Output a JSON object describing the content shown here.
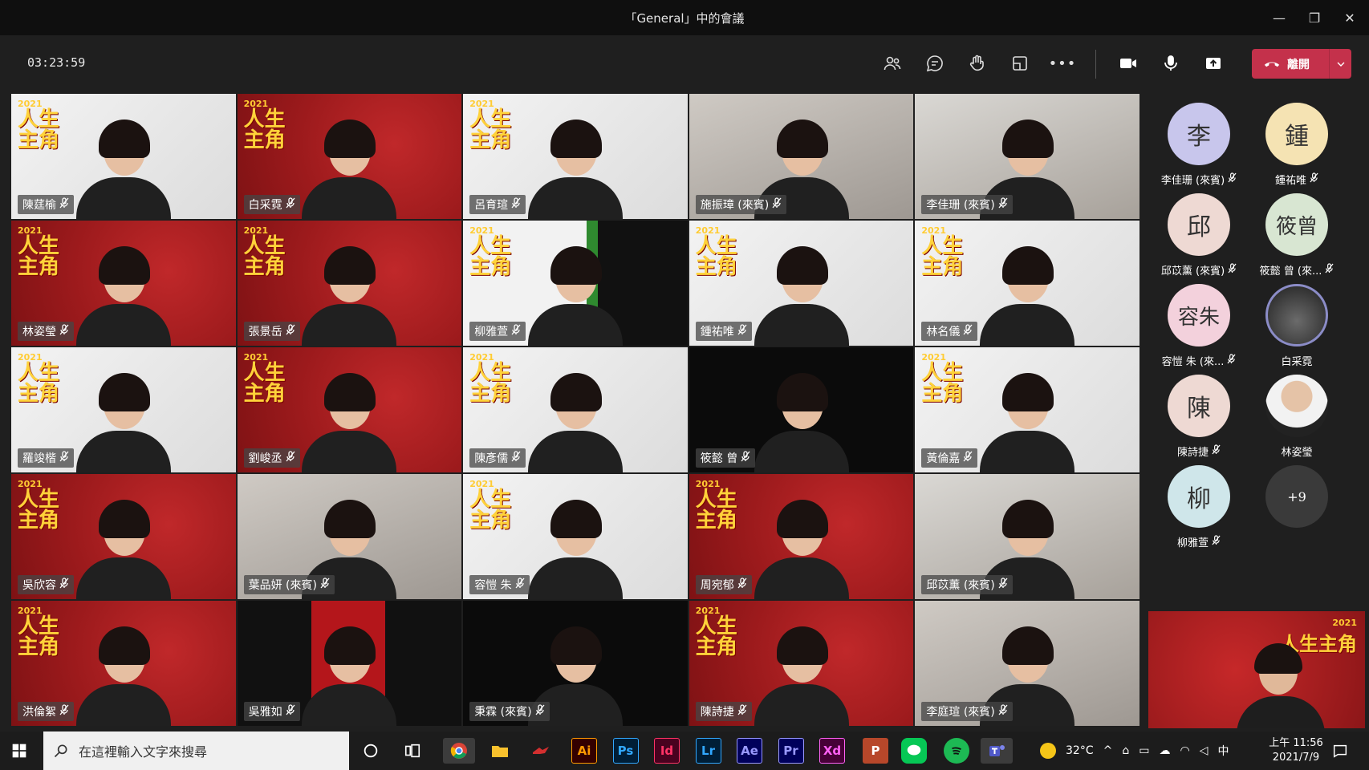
{
  "window": {
    "title": "「General」中的會議",
    "minimize_glyph": "—",
    "restore_glyph": "❐",
    "close_glyph": "✕"
  },
  "toolbar": {
    "timer": "03:23:59",
    "leave_label": "離開",
    "more_glyph": "•••",
    "leave_color": "#c4314b"
  },
  "participants": [
    {
      "name": "陳莛榆",
      "bg": "white"
    },
    {
      "name": "白采霓",
      "bg": "red"
    },
    {
      "name": "呂育瑄",
      "bg": "white"
    },
    {
      "name": "施振璋 (來賓)",
      "bg": "room"
    },
    {
      "name": "李佳珊 (來賓)",
      "bg": "room2"
    },
    {
      "name": "林姿瑩",
      "bg": "red"
    },
    {
      "name": "張景岳",
      "bg": "red"
    },
    {
      "name": "柳雅萱",
      "bg": "green"
    },
    {
      "name": "鍾祐唯",
      "bg": "white"
    },
    {
      "name": "林名儀",
      "bg": "white"
    },
    {
      "name": "羅竣楷",
      "bg": "white"
    },
    {
      "name": "劉峻丞",
      "bg": "red"
    },
    {
      "name": "陳彥儒",
      "bg": "white"
    },
    {
      "name": "筱懿 曾",
      "bg": "dark"
    },
    {
      "name": "黃倫嘉",
      "bg": "white"
    },
    {
      "name": "吳欣容",
      "bg": "red"
    },
    {
      "name": "葉品妍 (來賓)",
      "bg": "room"
    },
    {
      "name": "容愷 朱",
      "bg": "white"
    },
    {
      "name": "周宛郁",
      "bg": "red"
    },
    {
      "name": "邱苡薰 (來賓)",
      "bg": "room2"
    },
    {
      "name": "洪倫絮",
      "bg": "red"
    },
    {
      "name": "吳雅如",
      "bg": "split"
    },
    {
      "name": "秉霖 (來賓)",
      "bg": "dark"
    },
    {
      "name": "陳詩捷",
      "bg": "red"
    },
    {
      "name": "李庭瑄 (來賓)",
      "bg": "room"
    }
  ],
  "banner": {
    "year": "2021",
    "title": "人生主角"
  },
  "sidebar": [
    {
      "initials": "李",
      "name": "李佳珊 (來賓)",
      "color": "#c8c6ec",
      "muted": true
    },
    {
      "initials": "鍾",
      "name": "鍾祐唯",
      "color": "#f5e3b3",
      "muted": true
    },
    {
      "initials": "邱",
      "name": "邱苡薰 (來賓)",
      "color": "#eed9d3",
      "muted": true
    },
    {
      "initials": "筱曾",
      "name": "筱懿 曾 (來...",
      "color": "#d8e6d2",
      "muted": true
    },
    {
      "initials": "容朱",
      "name": "容愷 朱 (來...",
      "color": "#f3d1dc",
      "muted": true
    },
    {
      "initials": "",
      "name": "白采霓",
      "color": "#3b3b45",
      "muted": false
    },
    {
      "initials": "陳",
      "name": "陳詩捷",
      "color": "#eed9d3",
      "muted": true
    },
    {
      "initials": "",
      "name": "林姿瑩",
      "color": "#d9d9d9",
      "muted": false
    },
    {
      "initials": "柳",
      "name": "柳雅萱",
      "color": "#cfe6ea",
      "muted": true
    },
    {
      "initials": "+9",
      "name": "",
      "color": "#3a3a3a",
      "muted": false
    }
  ],
  "self_view": {
    "badge": "2021",
    "title": "人生主角"
  },
  "taskbar": {
    "search_placeholder": "在這裡輸入文字來搜尋",
    "apps": [
      {
        "label": "Ai",
        "color": "#330000",
        "fg": "#ff9a00"
      },
      {
        "label": "Ps",
        "color": "#001e36",
        "fg": "#31a8ff"
      },
      {
        "label": "Id",
        "color": "#49021f",
        "fg": "#ff3366"
      },
      {
        "label": "Lr",
        "color": "#001e36",
        "fg": "#31a8ff"
      },
      {
        "label": "Ae",
        "color": "#00005b",
        "fg": "#9999ff"
      },
      {
        "label": "Pr",
        "color": "#00005b",
        "fg": "#9999ff"
      },
      {
        "label": "Xd",
        "color": "#470137",
        "fg": "#ff61f6"
      }
    ],
    "temperature": "32°C",
    "ime": "中",
    "time": "上午 11:56",
    "date": "2021/7/9"
  }
}
